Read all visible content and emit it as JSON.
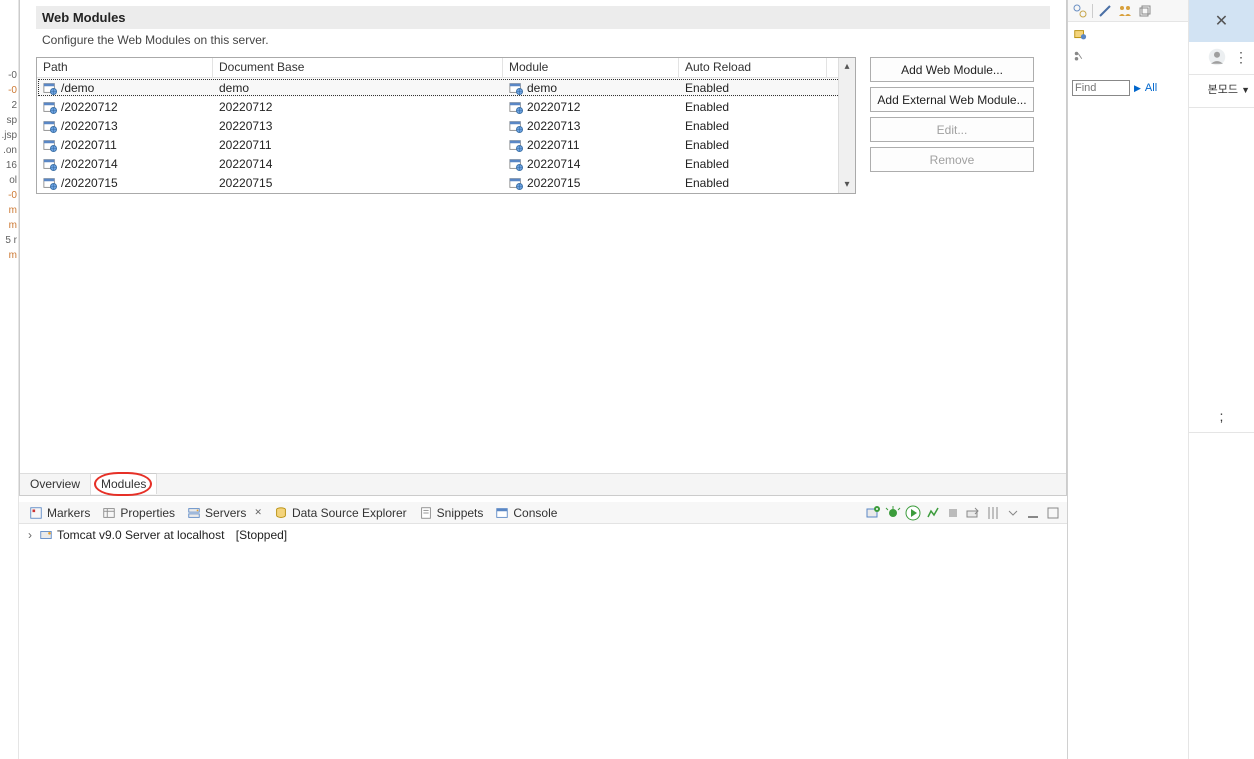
{
  "left_sliver": {
    "items": [
      "-0",
      "-0",
      "2",
      "sp",
      ".jsp",
      ".on",
      "16",
      "ol",
      "-0",
      "m",
      "m",
      "5 r",
      "m"
    ]
  },
  "section": {
    "title": "Web Modules",
    "subtitle": "Configure the Web Modules on this server."
  },
  "table": {
    "headers": {
      "path": "Path",
      "doc": "Document Base",
      "mod": "Module",
      "auto": "Auto Reload"
    },
    "rows": [
      {
        "path": "/demo",
        "doc": "demo",
        "mod": "demo",
        "auto": "Enabled",
        "selected": true
      },
      {
        "path": "/20220712",
        "doc": "20220712",
        "mod": "20220712",
        "auto": "Enabled",
        "selected": false
      },
      {
        "path": "/20220713",
        "doc": "20220713",
        "mod": "20220713",
        "auto": "Enabled",
        "selected": false
      },
      {
        "path": "/20220711",
        "doc": "20220711",
        "mod": "20220711",
        "auto": "Enabled",
        "selected": false
      },
      {
        "path": "/20220714",
        "doc": "20220714",
        "mod": "20220714",
        "auto": "Enabled",
        "selected": false
      },
      {
        "path": "/20220715",
        "doc": "20220715",
        "mod": "20220715",
        "auto": "Enabled",
        "selected": false
      }
    ]
  },
  "buttons": {
    "add": "Add Web Module...",
    "add_ext": "Add External Web Module...",
    "edit": "Edit...",
    "remove": "Remove"
  },
  "editor_tabs": {
    "overview": "Overview",
    "modules": "Modules"
  },
  "views": {
    "markers": "Markers",
    "properties": "Properties",
    "servers": "Servers",
    "dse": "Data Source Explorer",
    "snippets": "Snippets",
    "console": "Console"
  },
  "server_row": {
    "name": "Tomcat v9.0 Server at localhost",
    "status": "[Stopped]"
  },
  "right": {
    "find_placeholder": "Find",
    "all": "All"
  },
  "far_right": {
    "mode": "본모드"
  }
}
